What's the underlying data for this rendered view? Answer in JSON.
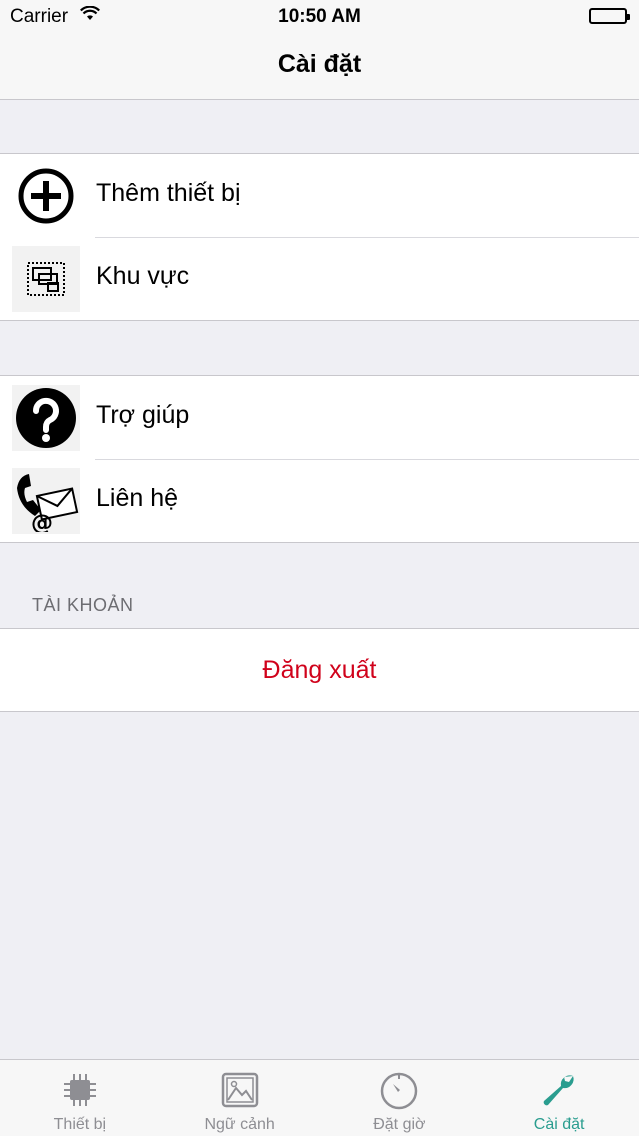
{
  "status_bar": {
    "carrier": "Carrier",
    "time": "10:50 AM"
  },
  "nav": {
    "title": "Cài đặt"
  },
  "groups": [
    {
      "items": [
        {
          "label": "Thêm thiết bị",
          "icon": "add-circle-icon"
        },
        {
          "label": "Khu vực",
          "icon": "floor-plan-icon"
        }
      ]
    },
    {
      "items": [
        {
          "label": "Trợ giúp",
          "icon": "help-circle-icon"
        },
        {
          "label": "Liên hệ",
          "icon": "phone-mail-icon"
        }
      ]
    }
  ],
  "account": {
    "header": "TÀI KHOẢN",
    "logout_label": "Đăng xuất"
  },
  "tabs": [
    {
      "label": "Thiết bị",
      "icon": "chip-icon",
      "active": false
    },
    {
      "label": "Ngữ cảnh",
      "icon": "picture-icon",
      "active": false
    },
    {
      "label": "Đặt giờ",
      "icon": "timer-icon",
      "active": false
    },
    {
      "label": "Cài đặt",
      "icon": "wrench-icon",
      "active": true
    }
  ],
  "colors": {
    "accent": "#2a9d8f",
    "destructive": "#d0021b",
    "background": "#efeff4"
  }
}
